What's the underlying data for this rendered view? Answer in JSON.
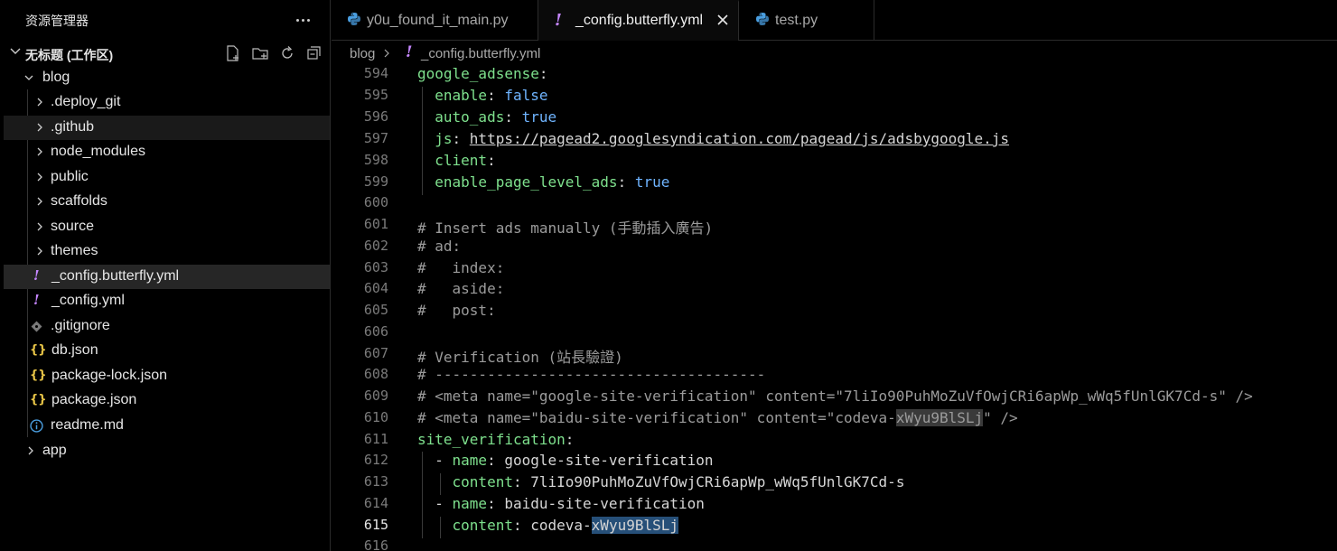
{
  "sidebar": {
    "title": "资源管理器",
    "more_label": "More Actions",
    "workspace": "无标题 (工作区)",
    "items": [
      {
        "label": "blog",
        "depth": 0,
        "kind": "folder-open"
      },
      {
        "label": ".deploy_git",
        "depth": 1,
        "kind": "folder"
      },
      {
        "label": ".github",
        "depth": 1,
        "kind": "folder"
      },
      {
        "label": "node_modules",
        "depth": 1,
        "kind": "folder"
      },
      {
        "label": "public",
        "depth": 1,
        "kind": "folder"
      },
      {
        "label": "scaffolds",
        "depth": 1,
        "kind": "folder"
      },
      {
        "label": "source",
        "depth": 1,
        "kind": "folder"
      },
      {
        "label": "themes",
        "depth": 1,
        "kind": "folder"
      },
      {
        "label": "_config.butterfly.yml",
        "depth": 1,
        "kind": "yaml-file"
      },
      {
        "label": "_config.yml",
        "depth": 1,
        "kind": "yaml-file"
      },
      {
        "label": ".gitignore",
        "depth": 1,
        "kind": "git-file"
      },
      {
        "label": "db.json",
        "depth": 1,
        "kind": "json-file"
      },
      {
        "label": "package-lock.json",
        "depth": 1,
        "kind": "json-file"
      },
      {
        "label": "package.json",
        "depth": 1,
        "kind": "json-file"
      },
      {
        "label": "readme.md",
        "depth": 1,
        "kind": "info-file"
      },
      {
        "label": "app",
        "depth": 0,
        "kind": "folder"
      }
    ]
  },
  "tabs": [
    {
      "label": "y0u_found_it_main.py",
      "icon": "python-icon"
    },
    {
      "label": "_config.butterfly.yml",
      "icon": "yaml-icon"
    },
    {
      "label": "test.py",
      "icon": "python-icon"
    }
  ],
  "breadcrumb": {
    "folder": "blog",
    "file": "_config.butterfly.yml"
  },
  "editor": {
    "current_line": "615",
    "lines": [
      {
        "n": "594"
      },
      {
        "n": "595"
      },
      {
        "n": "596"
      },
      {
        "n": "597"
      },
      {
        "n": "598"
      },
      {
        "n": "599"
      },
      {
        "n": "600"
      },
      {
        "n": "601"
      },
      {
        "n": "602"
      },
      {
        "n": "603"
      },
      {
        "n": "604"
      },
      {
        "n": "605"
      },
      {
        "n": "606"
      },
      {
        "n": "607"
      },
      {
        "n": "608"
      },
      {
        "n": "609"
      },
      {
        "n": "610"
      },
      {
        "n": "611"
      },
      {
        "n": "612"
      },
      {
        "n": "613"
      },
      {
        "n": "614"
      },
      {
        "n": "615"
      },
      {
        "n": "616"
      }
    ],
    "code": {
      "l594_key": "google_adsense",
      "l595_key": "enable",
      "l595_val": "false",
      "l596_key": "auto_ads",
      "l596_val": "true",
      "l597_key": "js",
      "l597_val": "https://pagead2.googlesyndication.com/pagead/js/adsbygoogle.js",
      "l598_key": "client",
      "l599_key": "enable_page_level_ads",
      "l599_val": "true",
      "l601": "# Insert ads manually (手動插入廣告)",
      "l602": "# ad:",
      "l603": "#   index:",
      "l604": "#   aside:",
      "l605": "#   post:",
      "l607": "# Verification (站長驗證)",
      "l608": "# --------------------------------------",
      "l609": "# <meta name=\"google-site-verification\" content=\"7liIo90PuhMoZuVfOwjCRi6apWp_wWq5fUnlGK7Cd-s\" />",
      "l610_a": "# <meta name=\"baidu-site-verification\" content=\"codeva-",
      "l610_hl": "xWyu9BlSLj",
      "l610_b": "\" />",
      "l611_key": "site_verification",
      "l612_key": "name",
      "l612_val": "google-site-verification",
      "l613_key": "content",
      "l613_val": "7liIo90PuhMoZuVfOwjCRi6apWp_wWq5fUnlGK7Cd-s",
      "l614_key": "name",
      "l614_val": "baidu-site-verification",
      "l615_key": "content",
      "l615_val_a": "codeva-",
      "l615_val_hl": "xWyu9BlSLj"
    }
  },
  "colors": {
    "key": "#7ee08d",
    "boolean": "#6fb4ff",
    "comment": "#9b9b9b",
    "yaml_mark": "#c586ff",
    "json_mark": "#e8c547",
    "python": "#4a9ee0"
  }
}
